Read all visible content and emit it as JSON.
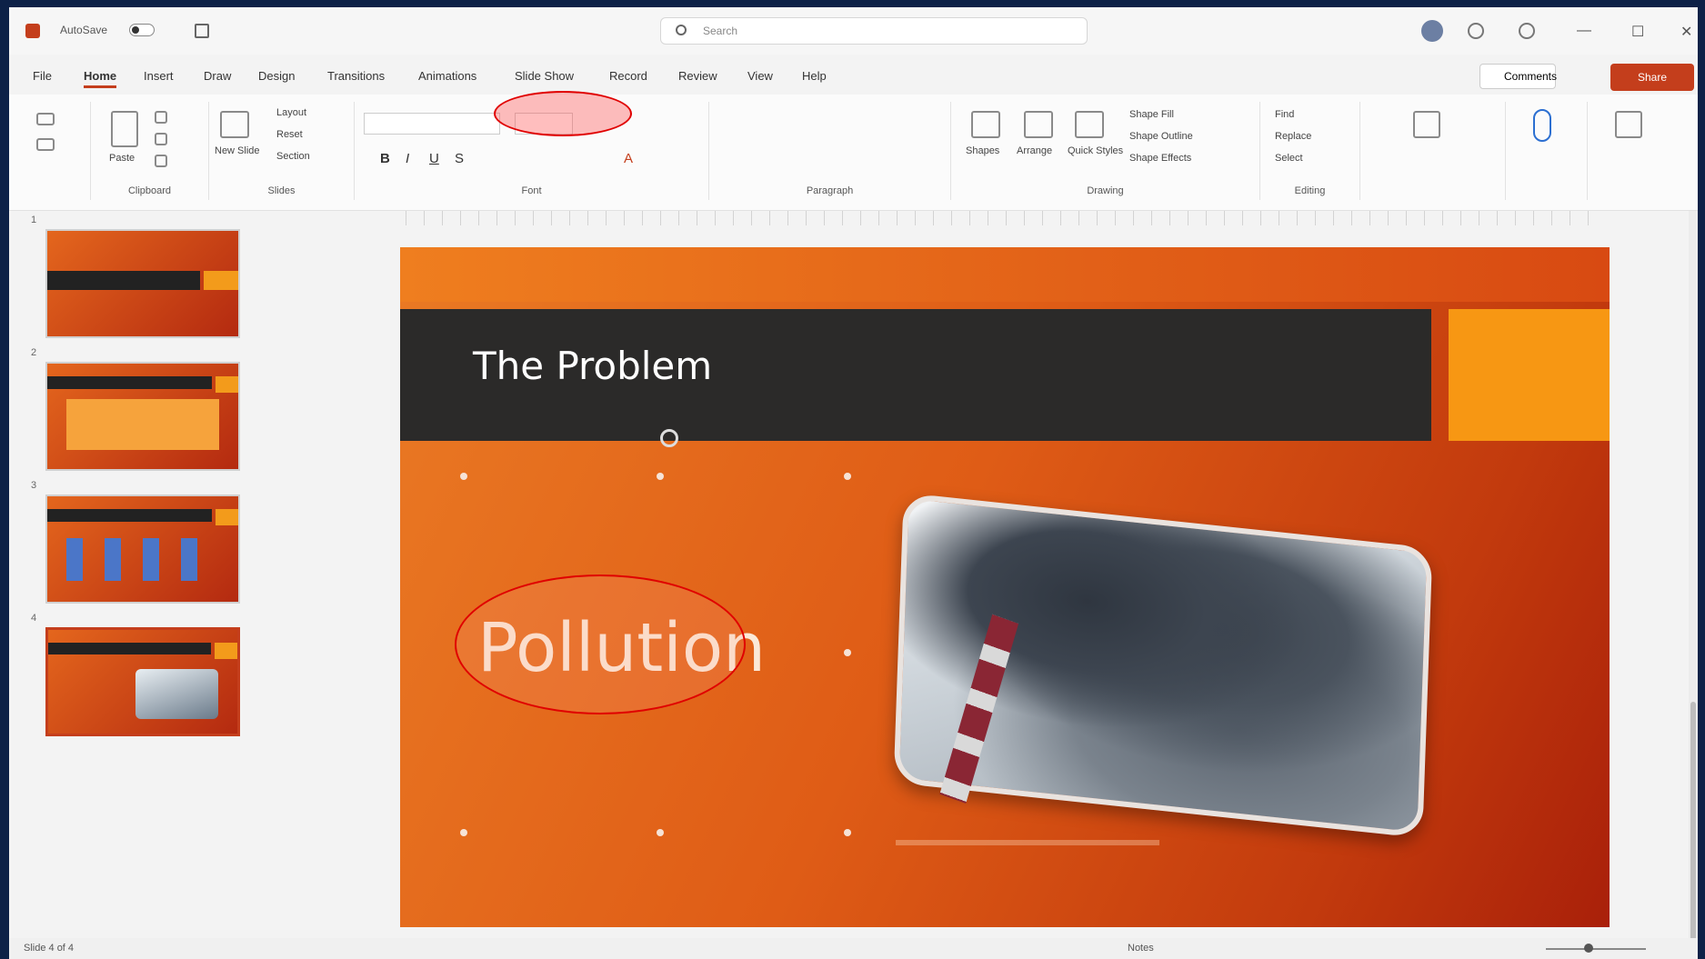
{
  "titlebar": {
    "app_name": "",
    "autosave_label": "AutoSave",
    "doc_title": "",
    "search_placeholder": "Search",
    "user_name": ""
  },
  "menu": {
    "tabs": [
      "File",
      "Home",
      "Insert",
      "Draw",
      "Design",
      "Transitions",
      "Animations",
      "Slide Show",
      "Record",
      "Review",
      "View",
      "Help"
    ],
    "active_tab": "Home",
    "comments_label": "Comments",
    "share_label": "Share"
  },
  "ribbon": {
    "font_name": "",
    "font_size": "",
    "groups": [
      "Clipboard",
      "Slides",
      "Font",
      "Paragraph",
      "Drawing",
      "Editing"
    ],
    "clipboard_labels": [
      "Paste"
    ],
    "slides_labels": [
      "New Slide",
      "Layout",
      "Reset",
      "Section"
    ],
    "drawing_labels": [
      "Shapes",
      "Arrange",
      "Quick Styles",
      "Shape Fill",
      "Shape Outline",
      "Shape Effects"
    ],
    "editing_labels": [
      "Find",
      "Replace",
      "Select"
    ]
  },
  "slides_pane": {
    "numbers": [
      "1",
      "2",
      "3",
      "4"
    ]
  },
  "slide": {
    "title": "The Problem",
    "body_text": "Pollution"
  },
  "statusbar": {
    "slide_info": "Slide 4 of 4",
    "notes_label": "Notes",
    "display_label": ""
  },
  "colors": {
    "accent": "#c43e1c",
    "slide_orange": "#e4661d",
    "title_bar": "#2b2a29",
    "accent_box": "#f79713",
    "highlight_oval": "#e00000"
  }
}
